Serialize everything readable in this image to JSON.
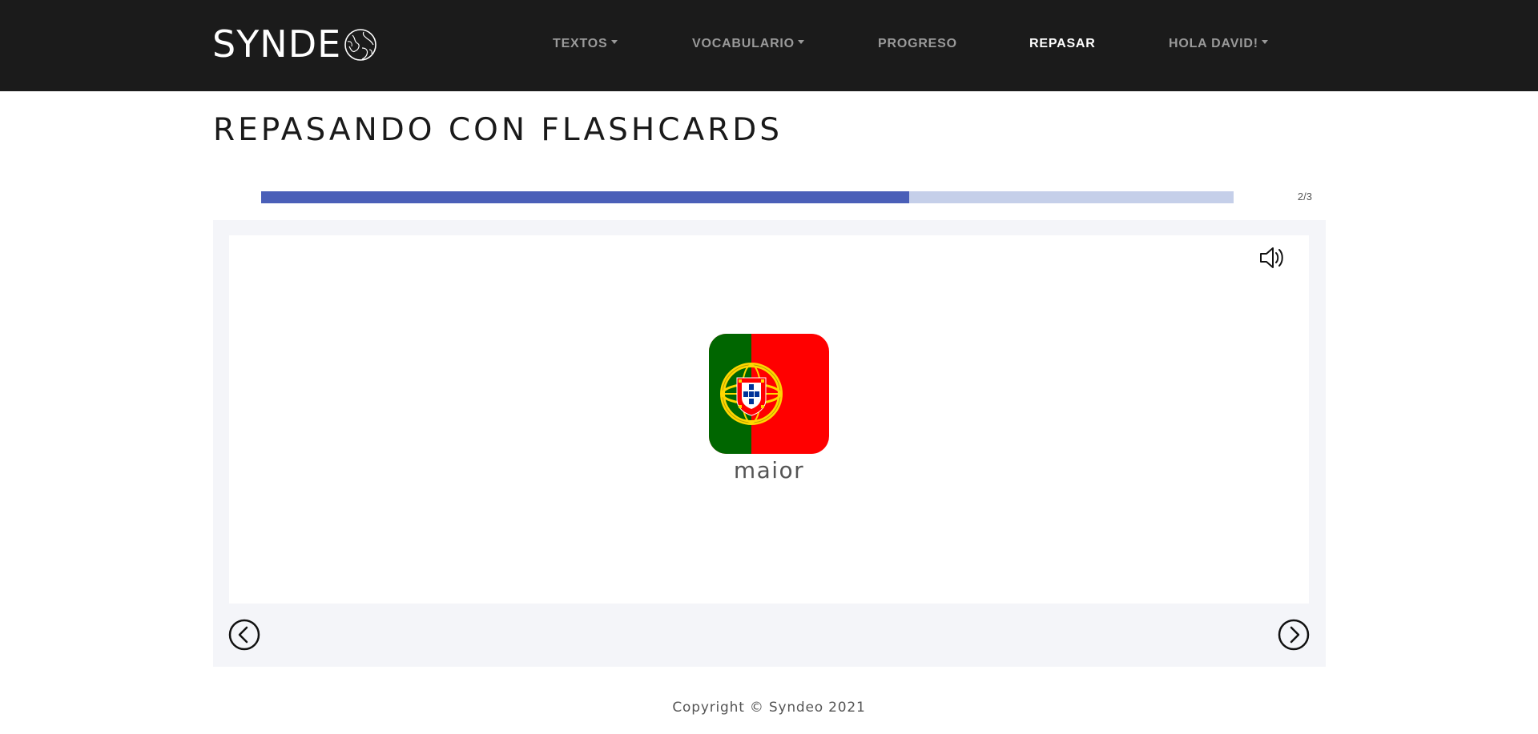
{
  "brand": {
    "name": "SYNDE"
  },
  "nav": {
    "textos": "TEXTOS",
    "vocabulario": "VOCABULARIO",
    "progreso": "PROGRESO",
    "repasar": "REPASAR",
    "user": "HOLA DAVID!"
  },
  "page": {
    "title": "REPASANDO CON FLASHCARDS"
  },
  "progress": {
    "current": 2,
    "total": 3,
    "label": "2/3",
    "fraction": 0.6667
  },
  "flashcard": {
    "word": "maior",
    "language_flag": "portugal-flag-icon",
    "audio_icon": "speaker-icon"
  },
  "controls": {
    "prev_icon": "chevron-left-circle-icon",
    "next_icon": "chevron-right-circle-icon"
  },
  "footer": {
    "copyright": "Copyright © Syndeo 2021"
  },
  "colors": {
    "navbar_bg": "#1b1b1b",
    "nav_active": "#ffffff",
    "nav_inactive": "#9a9a9a",
    "progress_fill": "#4a5fb8",
    "progress_track": "#c5cfe9",
    "card_bg": "#f4f5f9"
  }
}
